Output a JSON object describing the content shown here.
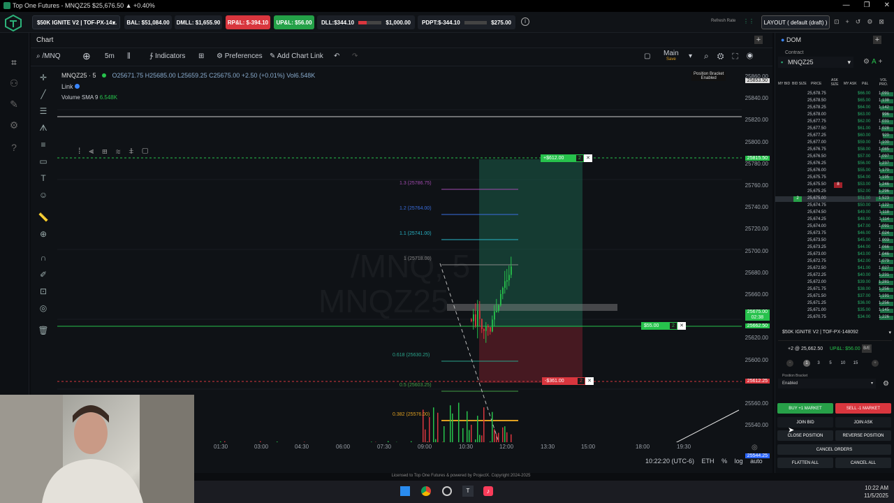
{
  "window": {
    "title": "Top One Futures - MNQZ25 $25,676.50 ▲ +0.40%",
    "controls": [
      "—",
      "❐",
      "✕"
    ]
  },
  "statusbar": {
    "account": "$50K IGNITE V2 | TOF-PX-14...",
    "bal": "BAL: $51,084.00",
    "dmll": "DMLL: $1,655.90",
    "rpl": "RP&L: $-394.10",
    "upl": "UP&L: $56.00",
    "dll": "DLL:$344.10",
    "dll_limit": "$1,000.00",
    "pdpt": "PDPT:$-344.10",
    "pdpt_limit": "$275.00",
    "refresh": "Refresh Rate",
    "layout": "LAYOUT ( default (draft) )",
    "colors": {
      "red": "#d9363e",
      "green": "#24a148",
      "accent": "#1f8a5a"
    }
  },
  "chart": {
    "tab": "Chart",
    "symbol_search": "/MNQ",
    "interval": "5m",
    "indicators": "Indicators",
    "preferences": "Preferences",
    "add_chart_link": "Add Chart Link",
    "layout_name": "Main",
    "layout_sub": "Save",
    "legend_symbol": "MNQZ25 · 5",
    "ohlc": "O25671.75 H25685.00 L25659.25 C25675.00 +2.50 (+0.01%) Vol6.548K",
    "link": "Link",
    "volume": "Volume SMA 9",
    "volume_val": "6.548K",
    "position_bracket": "Position Bracket",
    "position_bracket_sub": "Enabled",
    "watermark": "/MNQ, 5 MNQZ25",
    "fib": [
      {
        "label": "1.3 (25786.75)",
        "color": "#a24bb0"
      },
      {
        "label": "1.2 (25764.00)",
        "color": "#3a6ee0"
      },
      {
        "label": "1.1 (25741.00)",
        "color": "#29b6c8"
      },
      {
        "label": "1 (25718.00)",
        "color": "#888888"
      },
      {
        "label": "0.618 (25630.25)",
        "color": "#2aa38a"
      },
      {
        "label": "0.5 (25603.25)",
        "color": "#43a047"
      },
      {
        "label": "0.382 (25576.00)",
        "color": "#e0a020"
      }
    ],
    "tp_order": "+$612.00",
    "tp_qty": "2",
    "entry_order": "$55.00",
    "entry_qty": "2",
    "sl_order": "-$361.00",
    "sl_qty": "2",
    "y_ticks": [
      "25860.00",
      "25840.00",
      "25820.00",
      "25800.00",
      "25780.00",
      "25760.00",
      "25740.00",
      "25720.00",
      "25700.00",
      "25680.00",
      "25660.00",
      "25640.00",
      "25620.00",
      "25600.00",
      "25580.00",
      "25560.00",
      "25540.00"
    ],
    "price_tags": {
      "top": "25853.50",
      "tp": "25815.50",
      "last": "25675.00",
      "countdown": "02:38",
      "entry": "25662.50",
      "sl": "25612.25",
      "blue": "25544.25"
    },
    "x_ticks": [
      "5",
      "01:30",
      "03:00",
      "04:30",
      "06:00",
      "07:30",
      "09:00",
      "10:30",
      "12:00",
      "13:30",
      "15:00",
      "18:00",
      "19:30"
    ],
    "time": "10:22:20 (UTC-6)",
    "session": "ETH",
    "pct": "%",
    "log": "log",
    "auto": "auto"
  },
  "dom": {
    "title": "DOM",
    "contract_label": "Contract",
    "contract": "MNQZ25",
    "headers": [
      "MY BID",
      "BID SIZE",
      "PRICE",
      "ASK SIZE",
      "MY ASK",
      "P&L",
      "VOL PRO."
    ],
    "rows": [
      {
        "price": "25,678.75",
        "pl": "$66.00",
        "vol": "1,091"
      },
      {
        "price": "25,678.50",
        "pl": "$65.00",
        "vol": "1,138"
      },
      {
        "price": "25,678.25",
        "pl": "$64.00",
        "vol": "1,142"
      },
      {
        "price": "25,678.00",
        "pl": "$63.00",
        "vol": "996"
      },
      {
        "price": "25,677.75",
        "pl": "$62.00",
        "vol": "1,031"
      },
      {
        "price": "25,677.50",
        "pl": "$61.00",
        "vol": "1,028"
      },
      {
        "price": "25,677.25",
        "pl": "$60.00",
        "vol": "920"
      },
      {
        "price": "25,677.00",
        "pl": "$59.00",
        "vol": "1,100"
      },
      {
        "price": "25,676.75",
        "pl": "$58.00",
        "vol": "1,085"
      },
      {
        "price": "25,676.50",
        "pl": "$57.00",
        "vol": "1,097"
      },
      {
        "price": "25,676.25",
        "pl": "$56.00",
        "vol": "1,237"
      },
      {
        "price": "25,676.00",
        "pl": "$55.00",
        "vol": "1,170"
      },
      {
        "price": "25,675.75",
        "pl": "$54.00",
        "vol": "1,195"
      },
      {
        "price": "25,675.50",
        "pl": "$53.00",
        "vol": "1,246",
        "ask": "8"
      },
      {
        "price": "25,675.25",
        "pl": "$52.00",
        "vol": "1,296"
      },
      {
        "price": "25,675.00",
        "pl": "$51.00",
        "vol": "1,523",
        "bid": "2"
      },
      {
        "price": "25,674.75",
        "pl": "$50.00",
        "vol": "1,122"
      },
      {
        "price": "25,674.50",
        "pl": "$49.00",
        "vol": "1,118"
      },
      {
        "price": "25,674.25",
        "pl": "$48.00",
        "vol": "1,114"
      },
      {
        "price": "25,674.00",
        "pl": "$47.00",
        "vol": "1,091"
      },
      {
        "price": "25,673.75",
        "pl": "$46.00",
        "vol": "1,024"
      },
      {
        "price": "25,673.50",
        "pl": "$45.00",
        "vol": "1,003"
      },
      {
        "price": "25,673.25",
        "pl": "$44.00",
        "vol": "1,066"
      },
      {
        "price": "25,673.00",
        "pl": "$43.00",
        "vol": "1,046"
      },
      {
        "price": "25,672.75",
        "pl": "$42.00",
        "vol": "1,079"
      },
      {
        "price": "25,672.50",
        "pl": "$41.00",
        "vol": "1,027"
      },
      {
        "price": "25,672.25",
        "pl": "$40.00",
        "vol": "1,231"
      },
      {
        "price": "25,672.00",
        "pl": "$39.00",
        "vol": "1,281"
      },
      {
        "price": "25,671.75",
        "pl": "$38.00",
        "vol": "1,256"
      },
      {
        "price": "25,671.50",
        "pl": "$37.00",
        "vol": "1,191"
      },
      {
        "price": "25,671.25",
        "pl": "$36.00",
        "vol": "1,256"
      },
      {
        "price": "25,671.00",
        "pl": "$35.00",
        "vol": "1,145"
      },
      {
        "price": "25,670.75",
        "pl": "$34.00",
        "vol": "1,226"
      }
    ],
    "account": "$50K IGNITE V2 | TOF-PX-148092",
    "position": "+2 @ 25,662.50",
    "position_pl": "UP&L: $56.00",
    "be": "B/E",
    "qty": [
      "1",
      "3",
      "5",
      "10",
      "15"
    ],
    "bracket_label": "Position Bracket",
    "bracket_value": "Enabled",
    "buy_market": "BUY +1 MARKET",
    "sell_market": "SELL -1 MARKET",
    "join_bid": "JOIN BID",
    "join_ask": "JOIN ASK",
    "close_position": "CLOSE POSITION",
    "reverse_position": "REVERSE POSITION",
    "cancel_orders": "CANCEL ORDERS",
    "flatten_all": "FLATTEN ALL",
    "cancel_all": "CANCEL ALL"
  },
  "footer": {
    "license": "Licensed to Top One Futures & powered by ProjectX. Copyright 2024-2025"
  },
  "taskbar": {
    "time": "10:22 AM",
    "date": "11/5/2025"
  }
}
